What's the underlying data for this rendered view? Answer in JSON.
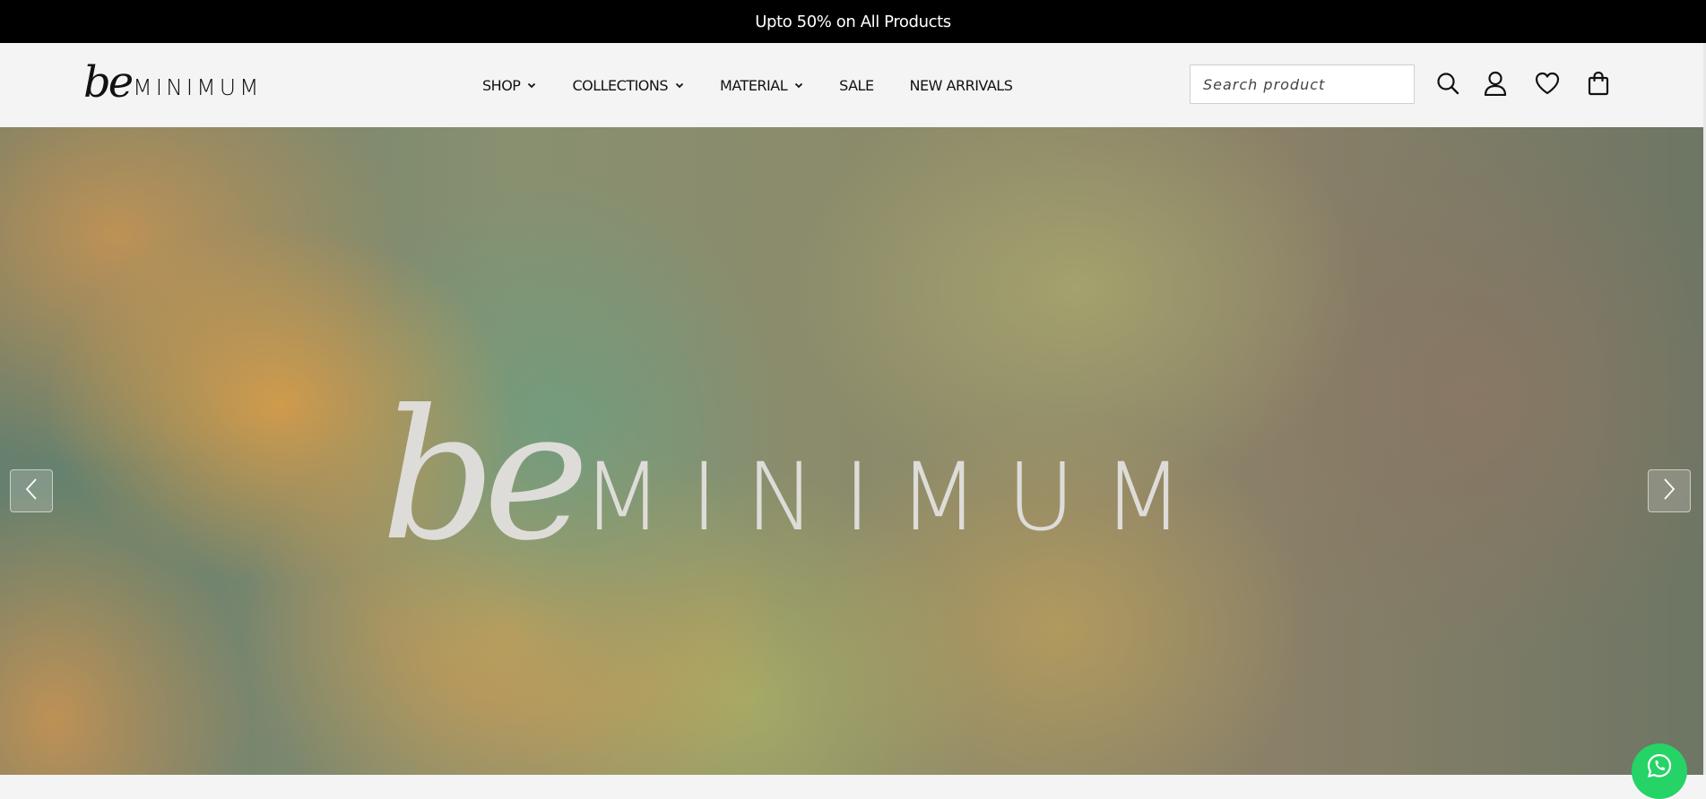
{
  "promo": {
    "text": "Upto 50% on All Products"
  },
  "brand": {
    "script": "be",
    "word": "MINIMUM"
  },
  "nav": {
    "items": [
      {
        "label": "SHOP",
        "has_dropdown": true
      },
      {
        "label": "COLLECTIONS",
        "has_dropdown": true
      },
      {
        "label": "MATERIAL",
        "has_dropdown": true
      },
      {
        "label": "SALE",
        "has_dropdown": false
      },
      {
        "label": "NEW ARRIVALS",
        "has_dropdown": false
      }
    ]
  },
  "search": {
    "placeholder": "Search product",
    "value": ""
  },
  "header_icons": [
    "search-icon",
    "user-icon",
    "heart-icon",
    "shopping-bag-icon"
  ],
  "hero": {
    "logo_script": "be",
    "logo_word": "MINIMUM",
    "prev_icon": "chevron-left-icon",
    "next_icon": "chevron-right-icon"
  },
  "whatsapp": {
    "icon": "whatsapp-icon",
    "color": "#25d366"
  },
  "colors": {
    "promo_bg": "#000000",
    "header_bg": "#f4f4f4",
    "text": "#111111"
  }
}
